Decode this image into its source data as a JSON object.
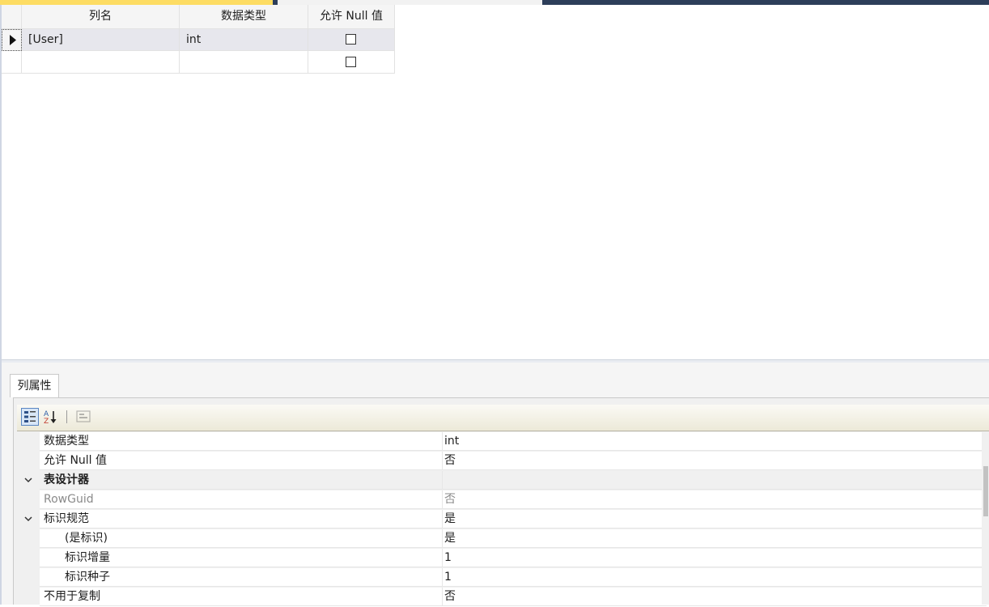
{
  "table_designer": {
    "headers": {
      "column_name": "列名",
      "data_type": "数据类型",
      "allow_null": "允许 Null 值"
    },
    "rows": [
      {
        "name": "[User]",
        "type": "int",
        "allow_null": false,
        "current": true
      },
      {
        "name": "",
        "type": "",
        "allow_null": false,
        "current": false
      }
    ]
  },
  "properties": {
    "tab_label": "列属性",
    "rows": [
      {
        "name": "数据类型",
        "value": "int"
      },
      {
        "name": "允许 Null 值",
        "value": "否"
      },
      {
        "name": "表设计器",
        "value": ""
      },
      {
        "name": "RowGuid",
        "value": "否"
      },
      {
        "name": "标识规范",
        "value": "是"
      },
      {
        "name": "(是标识)",
        "value": "是"
      },
      {
        "name": "标识增量",
        "value": "1"
      },
      {
        "name": "标识种子",
        "value": "1"
      },
      {
        "name": "不用于复制",
        "value": "否"
      }
    ]
  },
  "icons": {
    "row_selector": "row-pointer-icon",
    "categorized": "categorized-icon",
    "alphabetical": "sort-alphabetical-icon",
    "property_pages": "property-pages-icon",
    "expand": "chevron-down-icon"
  },
  "colors": {
    "active_tab": "#fddc63",
    "tab_strip": "#2d3e5a",
    "grid_header": "#f5f5f5",
    "toolbar": "#ece9d8"
  }
}
